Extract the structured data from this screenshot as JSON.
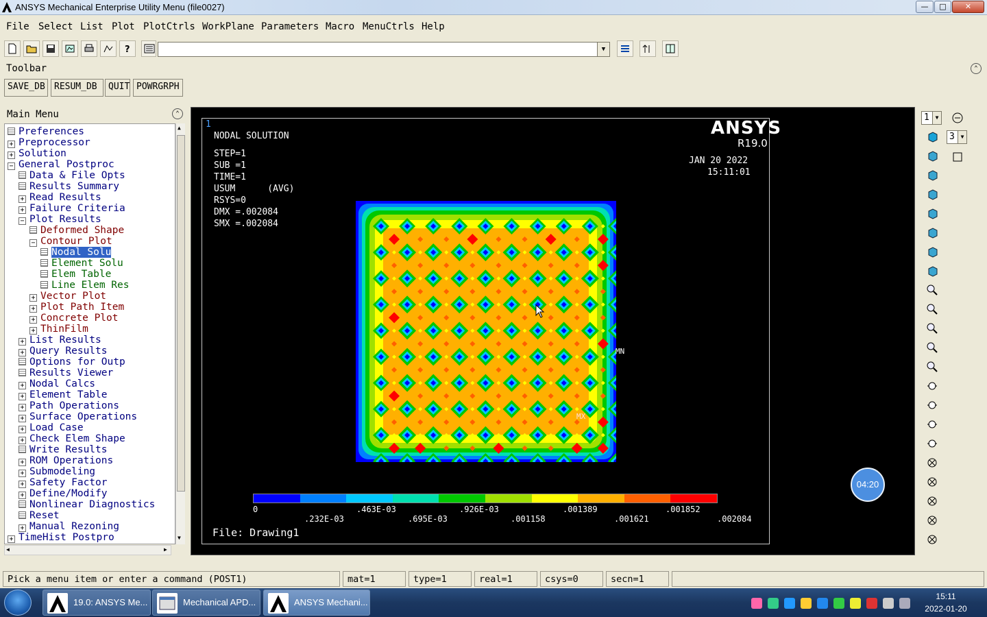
{
  "window": {
    "title": "ANSYS Mechanical Enterprise Utility Menu (file0027)",
    "controls": {
      "minimize": "—",
      "maximize": "□",
      "close": "✕"
    }
  },
  "menubar": [
    "File",
    "Select",
    "List",
    "Plot",
    "PlotCtrls",
    "WorkPlane",
    "Parameters",
    "Macro",
    "MenuCtrls",
    "Help"
  ],
  "command_input": {
    "value": ""
  },
  "toolbar": {
    "label": "Toolbar",
    "buttons": [
      "SAVE_DB",
      "RESUM_DB",
      "QUIT",
      "POWRGRPH"
    ]
  },
  "main_menu": {
    "title": "Main Menu",
    "items": [
      {
        "label": "Preferences",
        "kind": "doc",
        "level": 0,
        "color": "#000080"
      },
      {
        "label": "Preprocessor",
        "kind": "plus",
        "level": 0,
        "color": "#000080"
      },
      {
        "label": "Solution",
        "kind": "plus",
        "level": 0,
        "color": "#000080"
      },
      {
        "label": "General Postproc",
        "kind": "minus",
        "level": 0,
        "color": "#000080"
      },
      {
        "label": "Data & File Opts",
        "kind": "doc",
        "level": 1,
        "color": "#000080"
      },
      {
        "label": "Results Summary",
        "kind": "doc",
        "level": 1,
        "color": "#000080"
      },
      {
        "label": "Read Results",
        "kind": "plus",
        "level": 1,
        "color": "#000080"
      },
      {
        "label": "Failure Criteria",
        "kind": "plus",
        "level": 1,
        "color": "#000080"
      },
      {
        "label": "Plot Results",
        "kind": "minus",
        "level": 1,
        "color": "#000080"
      },
      {
        "label": "Deformed Shape",
        "kind": "doc",
        "level": 2,
        "color": "#800000"
      },
      {
        "label": "Contour Plot",
        "kind": "minus",
        "level": 2,
        "color": "#800000"
      },
      {
        "label": "Nodal Solu",
        "kind": "doc",
        "level": 3,
        "color": "#006400",
        "selected": true
      },
      {
        "label": "Element Solu",
        "kind": "doc",
        "level": 3,
        "color": "#006400"
      },
      {
        "label": "Elem Table",
        "kind": "doc",
        "level": 3,
        "color": "#006400"
      },
      {
        "label": "Line Elem Res",
        "kind": "doc",
        "level": 3,
        "color": "#006400"
      },
      {
        "label": "Vector Plot",
        "kind": "plus",
        "level": 2,
        "color": "#800000"
      },
      {
        "label": "Plot Path Item",
        "kind": "plus",
        "level": 2,
        "color": "#800000"
      },
      {
        "label": "Concrete Plot",
        "kind": "plus",
        "level": 2,
        "color": "#800000"
      },
      {
        "label": "ThinFilm",
        "kind": "plus",
        "level": 2,
        "color": "#800000"
      },
      {
        "label": "List Results",
        "kind": "plus",
        "level": 1,
        "color": "#000080"
      },
      {
        "label": "Query Results",
        "kind": "plus",
        "level": 1,
        "color": "#000080"
      },
      {
        "label": "Options for Outp",
        "kind": "doc",
        "level": 1,
        "color": "#000080"
      },
      {
        "label": "Results Viewer",
        "kind": "doc",
        "level": 1,
        "color": "#000080"
      },
      {
        "label": "Nodal Calcs",
        "kind": "plus",
        "level": 1,
        "color": "#000080"
      },
      {
        "label": "Element Table",
        "kind": "plus",
        "level": 1,
        "color": "#000080"
      },
      {
        "label": "Path Operations",
        "kind": "plus",
        "level": 1,
        "color": "#000080"
      },
      {
        "label": "Surface Operations",
        "kind": "plus",
        "level": 1,
        "color": "#000080"
      },
      {
        "label": "Load Case",
        "kind": "plus",
        "level": 1,
        "color": "#000080"
      },
      {
        "label": "Check Elem Shape",
        "kind": "plus",
        "level": 1,
        "color": "#000080"
      },
      {
        "label": "Write Results",
        "kind": "doc",
        "level": 1,
        "color": "#000080"
      },
      {
        "label": "ROM Operations",
        "kind": "plus",
        "level": 1,
        "color": "#000080"
      },
      {
        "label": "Submodeling",
        "kind": "plus",
        "level": 1,
        "color": "#000080"
      },
      {
        "label": "Safety Factor",
        "kind": "plus",
        "level": 1,
        "color": "#000080"
      },
      {
        "label": "Define/Modify",
        "kind": "plus",
        "level": 1,
        "color": "#000080"
      },
      {
        "label": "Nonlinear Diagnostics",
        "kind": "doc",
        "level": 1,
        "color": "#000080"
      },
      {
        "label": "Reset",
        "kind": "doc",
        "level": 1,
        "color": "#000080"
      },
      {
        "label": "Manual Rezoning",
        "kind": "plus",
        "level": 1,
        "color": "#000080"
      },
      {
        "label": "TimeHist Postpro",
        "kind": "plus",
        "level": 0,
        "color": "#000080"
      }
    ]
  },
  "graphics": {
    "window_number": "1",
    "header_lines": [
      "NODAL SOLUTION",
      "",
      "STEP=1",
      "SUB =1",
      "TIME=1",
      "USUM      (AVG)",
      "RSYS=0",
      "DMX =.002084",
      "SMX =.002084"
    ],
    "brand": "ANSYS",
    "version": "R19.0",
    "date": "JAN 20 2022",
    "time": "15:11:01",
    "mn_label": "MN",
    "mx_label": "MX",
    "legend": {
      "colors": [
        "#0000ff",
        "#0080ff",
        "#00c8ff",
        "#00e0b0",
        "#00c800",
        "#a0e000",
        "#ffff00",
        "#ffb000",
        "#ff6000",
        "#ff0000"
      ],
      "top_labels": [
        "0",
        ".463E-03",
        ".926E-03",
        ".001389",
        ".001852"
      ],
      "bottom_labels": [
        ".232E-03",
        ".695E-03",
        ".001158",
        ".001621",
        ".002084"
      ]
    },
    "file_label": "File: Drawing1",
    "timer": "04:20"
  },
  "right_toolbar": {
    "window_select": "1",
    "view_select": "3"
  },
  "status_bar": {
    "prompt": "Pick a menu item or enter a command (POST1)",
    "mat": "mat=1",
    "type": "type=1",
    "real": "real=1",
    "csys": "csys=0",
    "secn": "secn=1"
  },
  "taskbar": {
    "tasks": [
      "19.0: ANSYS Me...",
      "Mechanical APD...",
      "ANSYS Mechani..."
    ],
    "clock_time": "15:11",
    "clock_date": "2022-01-20"
  }
}
